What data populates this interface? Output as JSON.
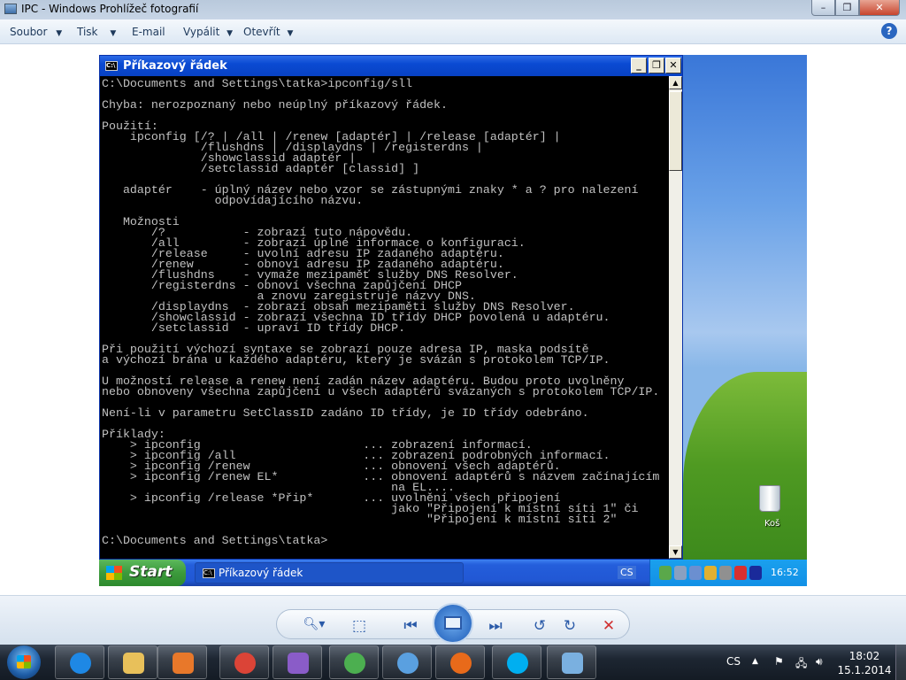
{
  "window": {
    "title": "IPC - Windows Prohlížeč fotografií",
    "controls": {
      "minimize": "–",
      "restore": "❐",
      "close": "✕"
    },
    "menu": [
      {
        "label": "Soubor",
        "dropdown": true
      },
      {
        "label": "Tisk",
        "dropdown": true
      },
      {
        "label": "E-mail",
        "dropdown": false
      },
      {
        "label": "Vypálit",
        "dropdown": true
      },
      {
        "label": "Otevřít",
        "dropdown": true
      }
    ],
    "help": "?"
  },
  "photo": {
    "cmd_window": {
      "title": "Příkazový řádek",
      "icon_text": "C:\\",
      "lines": [
        "C:\\Documents and Settings\\tatka>ipconfig/sll",
        "",
        "Chyba: nerozpoznaný nebo neúplný příkazový řádek.",
        "",
        "Použití:",
        "    ipconfig [/? | /all | /renew [adaptér] | /release [adaptér] |",
        "              /flushdns | /displaydns | /registerdns |",
        "              /showclassid adaptér |",
        "              /setclassid adaptér [classid] ]",
        "",
        "   adaptér    - úplný název nebo vzor se zástupnými znaky * a ? pro nalezení",
        "                odpovídajícího názvu.",
        "",
        "   Možnosti",
        "       /?           - zobrazí tuto nápovědu.",
        "       /all         - zobrazí úplné informace o konfiguraci.",
        "       /release     - uvolní adresu IP zadaného adaptéru.",
        "       /renew       - obnoví adresu IP zadaného adaptéru.",
        "       /flushdns    - vymaže mezipaměť služby DNS Resolver.",
        "       /registerdns - obnoví všechna zapůjčení DHCP",
        "                      a znovu zaregistruje názvy DNS.",
        "       /displaydns  - zobrazí obsah mezipaměti služby DNS Resolver.",
        "       /showclassid - zobrazí všechna ID třídy DHCP povolená u adaptéru.",
        "       /setclassid  - upraví ID třídy DHCP.",
        "",
        "Při použití výchozí syntaxe se zobrazí pouze adresa IP, maska podsítě",
        "a výchozí brána u každého adaptéru, který je svázán s protokolem TCP/IP.",
        "",
        "U možností release a renew není zadán název adaptéru. Budou proto uvolněny",
        "nebo obnoveny všechna zapůjčení u všech adaptérů svázaných s protokolem TCP/IP.",
        "",
        "Není-li v parametru SetClassID zadáno ID třídy, je ID třídy odebráno.",
        "",
        "Příklady:",
        "    > ipconfig                       ... zobrazení informací.",
        "    > ipconfig /all                  ... zobrazení podrobných informací.",
        "    > ipconfig /renew                ... obnovení všech adaptérů.",
        "    > ipconfig /renew EL*            ... obnovení adaptérů s názvem začínajícím",
        "                                         na EL....",
        "    > ipconfig /release *Přip*       ... uvolnění všech připojení",
        "                                         jako \"Připojení k místní síti 1\" či",
        "                                              \"Připojení k místní síti 2\"",
        "",
        "C:\\Documents and Settings\\tatka>"
      ]
    },
    "xp_taskbar": {
      "start": "Start",
      "task": "Příkazový řádek",
      "language": "CS",
      "clock": "16:52",
      "tray_colors": [
        "#5aa84a",
        "#8aa0c0",
        "#6b8fd0",
        "#e0b030",
        "#909090",
        "#d83030",
        "#1a2a9a"
      ]
    },
    "desktop_icon": "Koš"
  },
  "viewer_controls": {
    "zoom": "🔍︎▾",
    "fit": "⬚",
    "previous": "⏮",
    "next": "⏭",
    "rotate_left": "↺",
    "rotate_right": "↻",
    "delete": "✕"
  },
  "taskbar": {
    "pinned": [
      {
        "name": "internet-explorer",
        "color": "#1e88e5"
      },
      {
        "name": "windows-explorer",
        "color": "#e8c05a"
      },
      {
        "name": "media-center",
        "color": "#e8782a"
      },
      {
        "name": "chrome",
        "color": "#db4437"
      },
      {
        "name": "visual-studio",
        "color": "#8a5cc8"
      },
      {
        "name": "utorrent",
        "color": "#4caf50"
      },
      {
        "name": "windows-update",
        "color": "#5aa0e0"
      },
      {
        "name": "firefox",
        "color": "#e86a1a"
      },
      {
        "name": "skype",
        "color": "#00aff0"
      },
      {
        "name": "photo-viewer",
        "color": "#7ab0e0"
      }
    ],
    "language": "CS",
    "tray": {
      "show_hidden": "▲",
      "flag": "⚑",
      "network": "🖧",
      "volume": "🔊︎"
    },
    "time": "18:02",
    "date": "15.1.2014"
  }
}
